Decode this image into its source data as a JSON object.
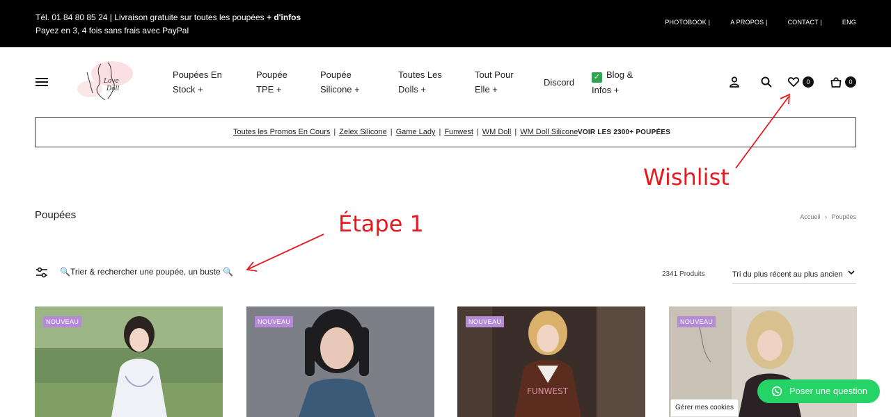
{
  "topbar": {
    "line1_prefix": "Tél. 01 84 80 85 24 | Livraison gratuite sur toutes les poupées ",
    "line1_bold": "+ d'infos",
    "line2": "Payez en 3, 4 fois sans frais avec PayPal",
    "links": [
      {
        "label": "PHOTOBOOK |"
      },
      {
        "label": "A PROPOS |"
      },
      {
        "label": "CONTACT |"
      },
      {
        "label": "ENG"
      }
    ]
  },
  "logo": {
    "text_line1": "Love",
    "text_line2": "Doll"
  },
  "nav": {
    "items": [
      {
        "line1": "Poupées En",
        "line2": "Stock +"
      },
      {
        "line1": "Poupée",
        "line2": "TPE +"
      },
      {
        "line1": "Poupée",
        "line2": "Silicone +"
      },
      {
        "line1": "Toutes Les",
        "line2": "Dolls +"
      },
      {
        "line1": "Tout Pour",
        "line2": "Elle +"
      },
      {
        "line1": "Discord",
        "line2": ""
      },
      {
        "line1": "Blog &",
        "line2": "Infos +",
        "check": "✓"
      }
    ]
  },
  "header_icons": {
    "account": "user-icon",
    "search": "search-icon",
    "wishlist": "heart-icon",
    "wishlist_count": "0",
    "cart": "bag-icon",
    "cart_count": "0"
  },
  "promo": {
    "links": [
      "Toutes les Promos En Cours",
      "Zelex Silicone",
      "Game Lady",
      "Funwest",
      "WM Doll",
      "WM Doll Silicone"
    ],
    "separator": "|",
    "all_label": "VOIR LES 2300+ POUPÉES"
  },
  "annotations": {
    "wishlist": "Wishlist",
    "step1": "Étape 1",
    "color": "#e8181f"
  },
  "page": {
    "title": "Poupées",
    "breadcrumb": {
      "home": "Accueil",
      "sep": "›",
      "current": "Poupées"
    }
  },
  "filter": {
    "label": "🔍Trier & rechercher une poupée, un buste 🔍"
  },
  "results": {
    "count": "2341 Produits",
    "sort_selected": "Tri du plus récent au plus ancien"
  },
  "products": [
    {
      "badge": "NOUVEAU"
    },
    {
      "badge": "NOUVEAU"
    },
    {
      "badge": "NOUVEAU"
    },
    {
      "badge": "NOUVEAU"
    }
  ],
  "chat": {
    "label": "Poser une question",
    "icon": "whatsapp-icon",
    "color": "#25d366"
  },
  "cookies": {
    "label": "Gérer mes cookies"
  }
}
